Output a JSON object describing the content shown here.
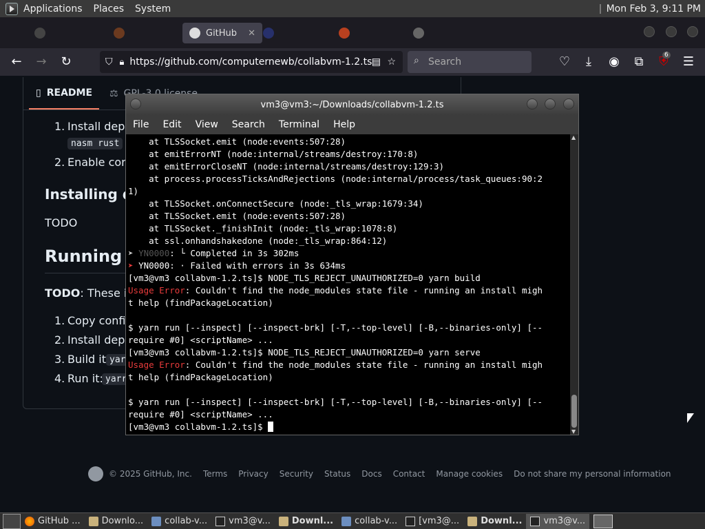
{
  "top_panel": {
    "applications": "Applications",
    "places": "Places",
    "system": "System",
    "clock": "Mon Feb  3, 9:11 PM"
  },
  "browser": {
    "active_tab": "GitHub",
    "url": "https://github.com/computernewb/collabvm-1.2.ts",
    "search_placeholder": "Search",
    "extension_badge": "6"
  },
  "github": {
    "readme_tab": "README",
    "license_tab": "GPL-3.0 license",
    "list1_item1": "Install deper",
    "list1_code": "nasm rust",
    "list1_item2": "Enable core",
    "heading_installing": "Installing de",
    "todo": "TODO",
    "heading_running": "Running",
    "todo_bold": "TODO",
    "todo_text": ": These in",
    "run_item1": "Copy config",
    "run_item2": "Install deper",
    "run_item3": "Build it:",
    "run_item3_code": "yar",
    "run_item4": "Run it:",
    "run_item4_code": "yarr"
  },
  "footer": {
    "copyright": "© 2025 GitHub, Inc.",
    "links": [
      "Terms",
      "Privacy",
      "Security",
      "Status",
      "Docs",
      "Contact",
      "Manage cookies",
      "Do not share my personal information"
    ]
  },
  "terminal": {
    "title": "vm3@vm3:~/Downloads/collabvm-1.2.ts",
    "menu": [
      "File",
      "Edit",
      "View",
      "Search",
      "Terminal",
      "Help"
    ],
    "lines": {
      "l01": "    at TLSSocket.emit (node:events:507:28)",
      "l02": "    at emitErrorNT (node:internal/streams/destroy:170:8)",
      "l03": "    at emitErrorCloseNT (node:internal/streams/destroy:129:3)",
      "l04": "    at process.processTicksAndRejections (node:internal/process/task_queues:90:2",
      "l05": "1)",
      "l06": "    at TLSSocket.onConnectSecure (node:_tls_wrap:1679:34)",
      "l07": "    at TLSSocket.emit (node:events:507:28)",
      "l08": "    at TLSSocket._finishInit (node:_tls_wrap:1078:8)",
      "l09": "    at ssl.onhandshakedone (node:_tls_wrap:864:12)",
      "l10_code": "YN0000",
      "l10_text": ": └ Completed in 3s 302ms",
      "l11_code": "YN0000",
      "l11_text": ": · Failed with errors in 3s 634ms",
      "l12": "[vm3@vm3 collabvm-1.2.ts]$ NODE_TLS_REJECT_UNAUTHORIZED=0 yarn build",
      "l13_err": "Usage Error",
      "l13_text": ": Couldn't find the node_modules state file - running an install migh",
      "l14": "t help (findPackageLocation)",
      "l15": "",
      "l16": "$ yarn run [--inspect] [--inspect-brk] [-T,--top-level] [-B,--binaries-only] [--",
      "l17": "require #0] <scriptName> ...",
      "l18": "[vm3@vm3 collabvm-1.2.ts]$ NODE_TLS_REJECT_UNAUTHORIZED=0 yarn serve",
      "l19_err": "Usage Error",
      "l19_text": ": Couldn't find the node_modules state file - running an install migh",
      "l20": "t help (findPackageLocation)",
      "l21": "",
      "l22": "$ yarn run [--inspect] [--inspect-brk] [-T,--top-level] [-B,--binaries-only] [--",
      "l23": "require #0] <scriptName> ...",
      "l24": "[vm3@vm3 collabvm-1.2.ts]$ "
    }
  },
  "taskbar": {
    "items": [
      {
        "label": "GitHub ...",
        "icon": "firefox-icon",
        "bold": false
      },
      {
        "label": "Downlo...",
        "icon": "folder-icon",
        "bold": false
      },
      {
        "label": "collab-v...",
        "icon": "app-icon",
        "bold": false
      },
      {
        "label": "vm3@v...",
        "icon": "terminal-icon",
        "bold": false
      },
      {
        "label": "Downl...",
        "icon": "folder-icon",
        "bold": true
      },
      {
        "label": "collab-v...",
        "icon": "app-icon",
        "bold": false
      },
      {
        "label": "[vm3@...",
        "icon": "terminal-icon",
        "bold": false
      },
      {
        "label": "Downl...",
        "icon": "folder-icon",
        "bold": true
      },
      {
        "label": "vm3@v...",
        "icon": "terminal-icon",
        "bold": false
      }
    ]
  }
}
